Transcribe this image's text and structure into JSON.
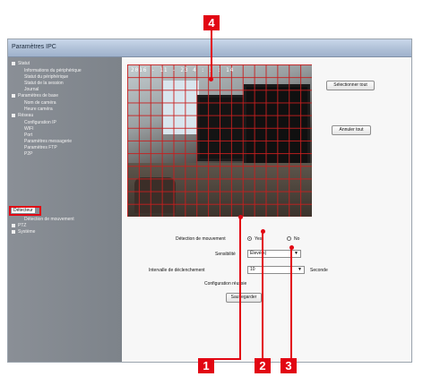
{
  "window": {
    "title": "Paramètres IPC"
  },
  "sidebar": {
    "items": [
      {
        "label": "Statut",
        "level": 0
      },
      {
        "label": "Informations du périphérique",
        "level": 1
      },
      {
        "label": "Statut du périphérique",
        "level": 1
      },
      {
        "label": "Statut de la session",
        "level": 1
      },
      {
        "label": "Journal",
        "level": 1
      },
      {
        "label": "Paramètres de base",
        "level": 0
      },
      {
        "label": "Nom de caméra",
        "level": 1
      },
      {
        "label": "Heure caméra",
        "level": 1
      },
      {
        "label": "Réseau",
        "level": 0
      },
      {
        "label": "Configuration IP",
        "level": 1
      },
      {
        "label": "WIFI",
        "level": 1
      },
      {
        "label": "Port",
        "level": 1
      },
      {
        "label": "Paramètres messagerie",
        "level": 1
      },
      {
        "label": "Paramètres FTP",
        "level": 1
      },
      {
        "label": "P2P",
        "level": 1
      },
      {
        "label": "Détecteur",
        "level": 0
      },
      {
        "label": "Détection de mouvement",
        "level": 1
      },
      {
        "label": "PTZ",
        "level": 0
      },
      {
        "label": "Système",
        "level": 0
      }
    ]
  },
  "camera": {
    "timestamp": "2016 - 11 - 23  4 : 3 : 14"
  },
  "buttons": {
    "select_all": "Sélectionner tout",
    "cancel_all": "Annuler tout",
    "save": "Sauvegarder"
  },
  "motion": {
    "label": "Détection de mouvement",
    "yes": "Yes",
    "no": "No",
    "selected": "yes"
  },
  "sensitivity": {
    "label": "Sensibilité",
    "value": "Élevé(s)"
  },
  "interval": {
    "label": "Intervalle de déclenchement",
    "value": "10",
    "unit": "Seconde"
  },
  "status": {
    "text": "Configuration réussie"
  },
  "callouts": [
    "1",
    "2",
    "3",
    "4"
  ],
  "colors": {
    "accent": "#e20613",
    "grid": "#c81e1e"
  }
}
